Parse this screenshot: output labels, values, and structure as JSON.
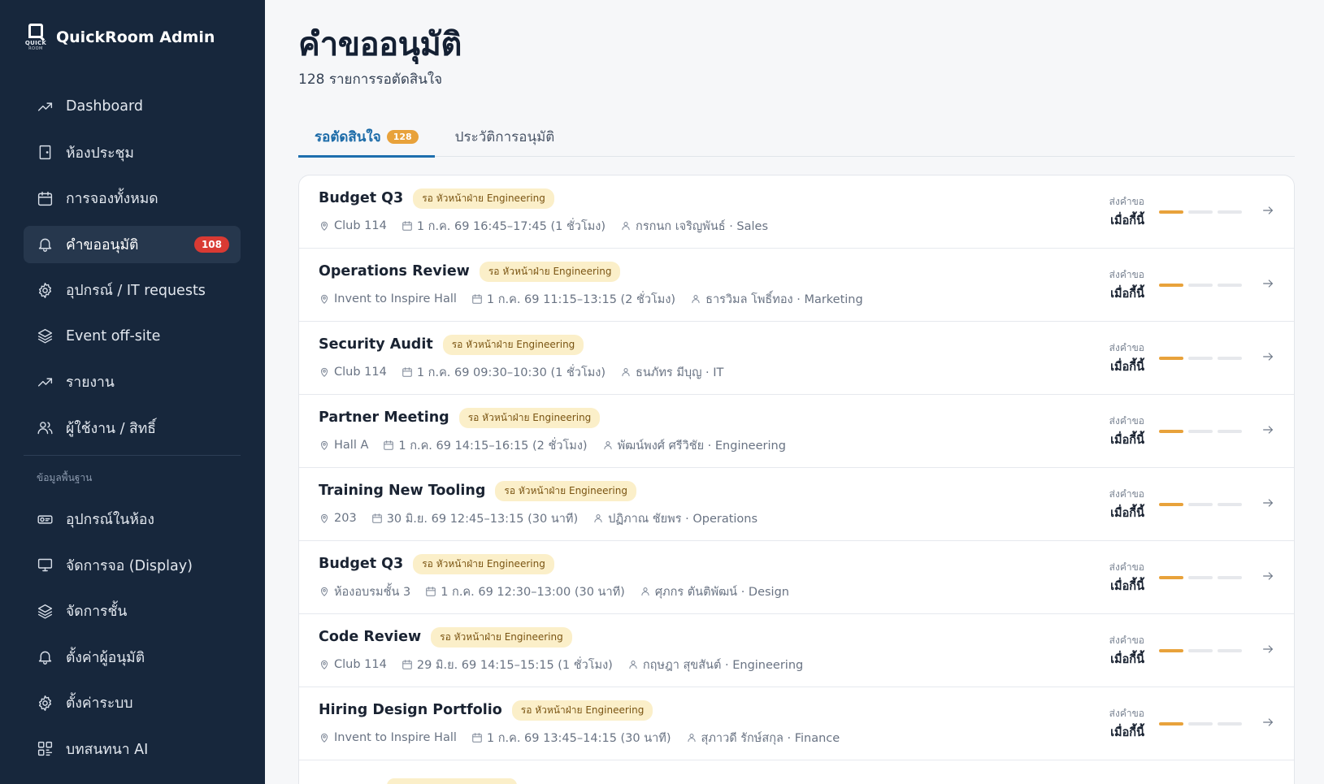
{
  "brand": {
    "logo_line1": "QUICK",
    "logo_line2": "ROOM",
    "name": "QuickRoom Admin"
  },
  "nav": [
    {
      "label": "Dashboard",
      "icon": "trending-up-icon"
    },
    {
      "label": "ห้องประชุม",
      "icon": "door-icon"
    },
    {
      "label": "การจองทั้งหมด",
      "icon": "calendar-icon"
    },
    {
      "label": "คำขออนุมัติ",
      "icon": "bell-icon",
      "badge": "108",
      "active": true
    },
    {
      "label": "อุปกรณ์ / IT requests",
      "icon": "gear-icon"
    },
    {
      "label": "Event off-site",
      "icon": "layers-icon"
    },
    {
      "label": "รายงาน",
      "icon": "trending-up-icon"
    },
    {
      "label": "ผู้ใช้งาน / สิทธิ์",
      "icon": "users-icon"
    }
  ],
  "section_label": "ข้อมูลพื้นฐาน",
  "nav2": [
    {
      "label": "อุปกรณ์ในห้อง",
      "icon": "projector-icon"
    },
    {
      "label": "จัดการจอ (Display)",
      "icon": "monitor-icon"
    },
    {
      "label": "จัดการชั้น",
      "icon": "layers-icon"
    },
    {
      "label": "ตั้งค่าผู้อนุมัติ",
      "icon": "bell-icon"
    },
    {
      "label": "ตั้งค่าระบบ",
      "icon": "gear-icon"
    },
    {
      "label": "บทสนทนา AI",
      "icon": "grid-icon"
    }
  ],
  "page": {
    "title": "คำขออนุมัติ",
    "subtitle": "128 รายการรอตัดสินใจ"
  },
  "tabs": [
    {
      "label": "รอตัดสินใจ",
      "count": "128",
      "active": true
    },
    {
      "label": "ประวัติการอนุมัติ"
    }
  ],
  "colors": {
    "accent": "#1e6fae",
    "pending": "#e8a23b",
    "badge": "#d93a33",
    "sidebar": "#17273c"
  },
  "requests": [
    {
      "title": "Budget Q3",
      "status": "รอ หัวหน้าฝ่าย Engineering",
      "room": "Club 114",
      "time": "1 ก.ค. 69 16:45–17:45 (1 ชั่วโมง)",
      "requester": "กรกนก เจริญพันธ์ · Sales",
      "sent_label": "ส่งคำขอ",
      "sent_value": "เมื่อกี้นี้",
      "step": 1,
      "steps": 3
    },
    {
      "title": "Operations Review",
      "status": "รอ หัวหน้าฝ่าย Engineering",
      "room": "Invent to Inspire Hall",
      "time": "1 ก.ค. 69 11:15–13:15 (2 ชั่วโมง)",
      "requester": "ธารวิมล โพธิ์ทอง · Marketing",
      "sent_label": "ส่งคำขอ",
      "sent_value": "เมื่อกี้นี้",
      "step": 1,
      "steps": 3
    },
    {
      "title": "Security Audit",
      "status": "รอ หัวหน้าฝ่าย Engineering",
      "room": "Club 114",
      "time": "1 ก.ค. 69 09:30–10:30 (1 ชั่วโมง)",
      "requester": "ธนภัทร มีบุญ · IT",
      "sent_label": "ส่งคำขอ",
      "sent_value": "เมื่อกี้นี้",
      "step": 1,
      "steps": 3
    },
    {
      "title": "Partner Meeting",
      "status": "รอ หัวหน้าฝ่าย Engineering",
      "room": "Hall A",
      "time": "1 ก.ค. 69 14:15–16:15 (2 ชั่วโมง)",
      "requester": "พัฒน์พงศ์ ศรีวิชัย · Engineering",
      "sent_label": "ส่งคำขอ",
      "sent_value": "เมื่อกี้นี้",
      "step": 1,
      "steps": 3
    },
    {
      "title": "Training New Tooling",
      "status": "รอ หัวหน้าฝ่าย Engineering",
      "room": "203",
      "time": "30 มิ.ย. 69 12:45–13:15 (30 นาที)",
      "requester": "ปฏิภาณ ชัยพร · Operations",
      "sent_label": "ส่งคำขอ",
      "sent_value": "เมื่อกี้นี้",
      "step": 1,
      "steps": 3
    },
    {
      "title": "Budget Q3",
      "status": "รอ หัวหน้าฝ่าย Engineering",
      "room": "ห้องอบรมชั้น 3",
      "time": "1 ก.ค. 69 12:30–13:00 (30 นาที)",
      "requester": "ศุภกร ตันติพัฒน์ · Design",
      "sent_label": "ส่งคำขอ",
      "sent_value": "เมื่อกี้นี้",
      "step": 1,
      "steps": 3
    },
    {
      "title": "Code Review",
      "status": "รอ หัวหน้าฝ่าย Engineering",
      "room": "Club 114",
      "time": "29 มิ.ย. 69 14:15–15:15 (1 ชั่วโมง)",
      "requester": "กฤษฎา สุขสันต์ · Engineering",
      "sent_label": "ส่งคำขอ",
      "sent_value": "เมื่อกี้นี้",
      "step": 1,
      "steps": 3
    },
    {
      "title": "Hiring Design Portfolio",
      "status": "รอ หัวหน้าฝ่าย Engineering",
      "room": "Invent to Inspire Hall",
      "time": "1 ก.ค. 69 13:45–14:15 (30 นาที)",
      "requester": "สุภาวดี รักษ์สกุล · Finance",
      "sent_label": "ส่งคำขอ",
      "sent_value": "เมื่อกี้นี้",
      "step": 1,
      "steps": 3
    }
  ]
}
